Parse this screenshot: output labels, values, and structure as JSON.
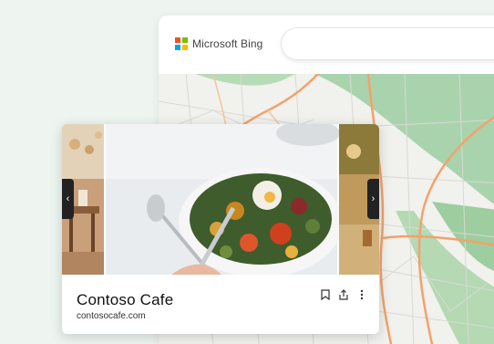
{
  "header": {
    "brand_label": "Microsoft Bing",
    "logo_colors": [
      "#f25022",
      "#7fba00",
      "#00a4ef",
      "#ffb900"
    ]
  },
  "search": {
    "value": ""
  },
  "card": {
    "title": "Contoso Cafe",
    "url": "contosocafe.com",
    "icons": {
      "prev": "chevron-left-icon",
      "next": "chevron-right-icon",
      "save": "bookmark-icon",
      "share": "share-icon",
      "more": "more-vertical-icon"
    }
  },
  "colors": {
    "map_road": "#f3a26b",
    "map_terrain": "#a9d3ad",
    "card_bg": "#ffffff"
  }
}
